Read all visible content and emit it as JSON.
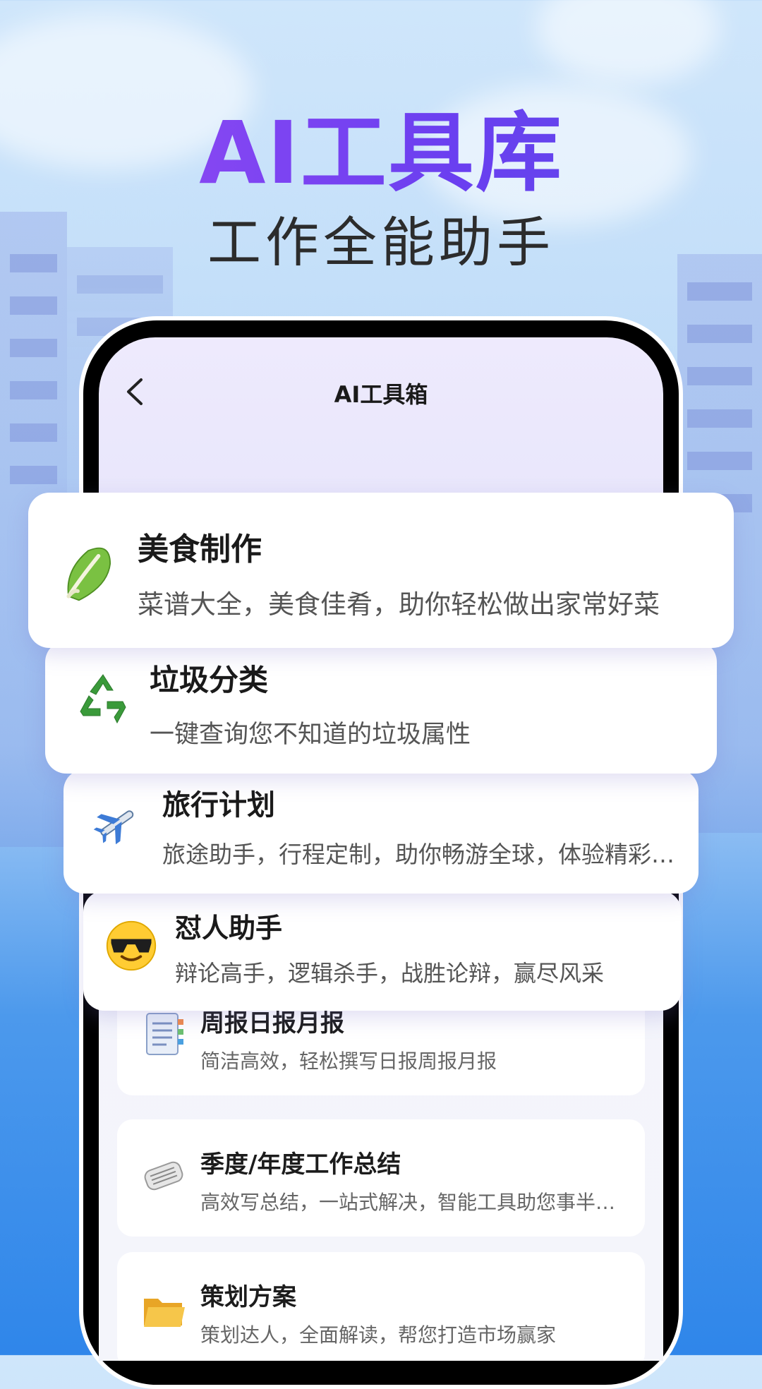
{
  "hero": {
    "title": "AI工具库",
    "subtitle": "工作全能助手"
  },
  "app": {
    "title": "AI工具箱"
  },
  "featured_cards": [
    {
      "title": "美食制作",
      "desc": "菜谱大全，美食佳肴，助你轻松做出家常好菜",
      "icon": "cabbage-icon"
    },
    {
      "title": "垃圾分类",
      "desc": "一键查询您不知道的垃圾属性",
      "icon": "recycle-icon"
    },
    {
      "title": "旅行计划",
      "desc": "旅途助手，行程定制，助你畅游全球，体验精彩旅程",
      "icon": "airplane-icon"
    },
    {
      "title": "怼人助手",
      "desc": "辩论高手，逻辑杀手，战胜论辩，赢尽风采",
      "icon": "sunglasses-face-icon"
    }
  ],
  "tools": [
    {
      "title": "周报日报月报",
      "desc": "简洁高效，轻松撰写日报周报月报",
      "icon": "notebook-icon"
    },
    {
      "title": "季度/年度工作总结",
      "desc": "高效写总结，一站式解决，智能工具助您事半功倍",
      "icon": "newspaper-icon"
    },
    {
      "title": "策划方案",
      "desc": "策划达人，全面解读，帮您打造市场赢家",
      "icon": "folder-icon"
    }
  ]
}
